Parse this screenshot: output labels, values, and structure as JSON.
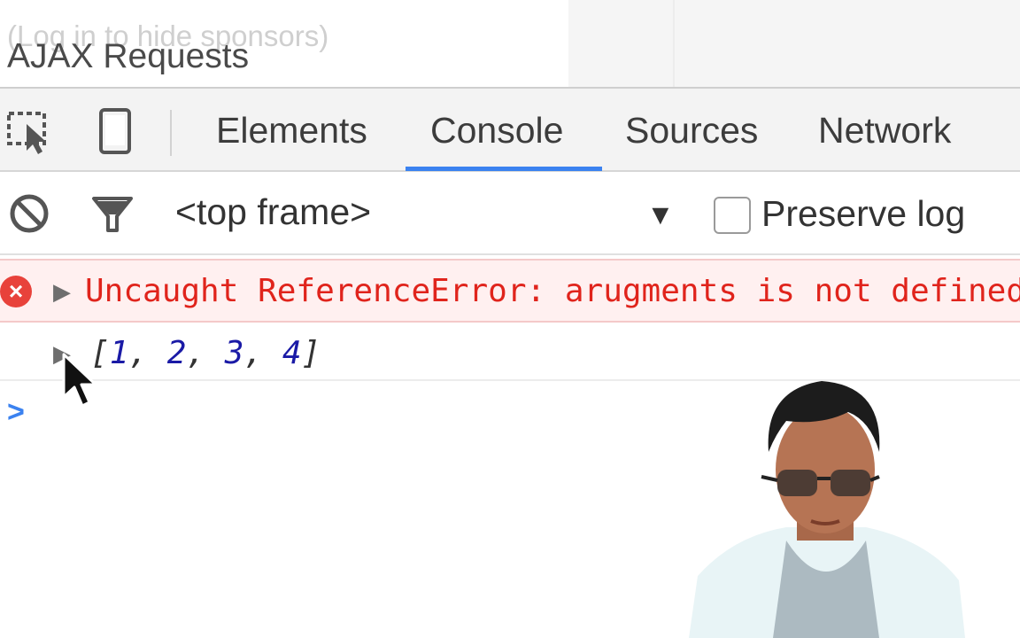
{
  "page": {
    "sponsor_note": "(Log in to hide sponsors)",
    "heading": "AJAX Requests"
  },
  "devtools": {
    "tool_icons": [
      "inspect-element-icon",
      "device-toolbar-icon"
    ],
    "tabs": [
      {
        "label": "Elements",
        "active": false
      },
      {
        "label": "Console",
        "active": true
      },
      {
        "label": "Sources",
        "active": false
      },
      {
        "label": "Network",
        "active": false
      }
    ],
    "accent_color": "#3b82f0"
  },
  "console_toolbar": {
    "icons": [
      "clear-console-icon",
      "filter-icon"
    ],
    "frame_select": "<top frame>",
    "preserve_log_label": "Preserve log",
    "preserve_log_checked": false
  },
  "console": {
    "error_message": "Uncaught ReferenceError: arugments is not defined",
    "error_color": "#e0241c",
    "array_open": "[",
    "array_items": [
      "1",
      "2",
      "3",
      "4"
    ],
    "array_close": "]",
    "prompt_symbol": ">"
  }
}
